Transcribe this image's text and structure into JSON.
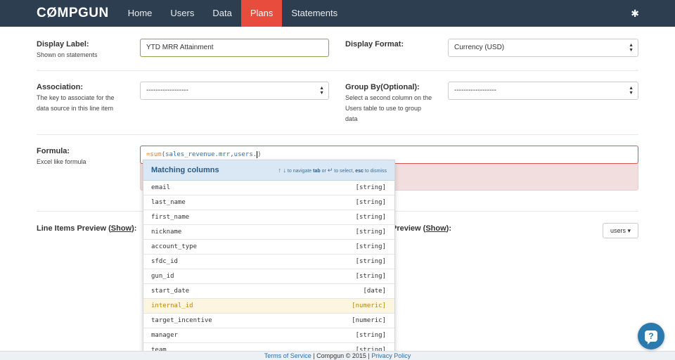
{
  "navbar": {
    "brand": "CØMPGUN",
    "items": [
      {
        "label": "Home"
      },
      {
        "label": "Users"
      },
      {
        "label": "Data"
      },
      {
        "label": "Plans",
        "active": true
      },
      {
        "label": "Statements"
      }
    ],
    "settings_icon": "gear-icon"
  },
  "form": {
    "display_label": {
      "label": "Display Label:",
      "help": "Shown on statements",
      "value": "YTD MRR Attainment"
    },
    "display_format": {
      "label": "Display Format:",
      "value": "Currency (USD)"
    },
    "association": {
      "label": "Association:",
      "help_line1": "The key to associate for the",
      "help_line2": "data source in this line item",
      "value": "------------------"
    },
    "group_by": {
      "label": "Group By(Optional):",
      "help_line1": "Select a second column on the",
      "help_line2": "Users table to use to group",
      "help_line3": "data",
      "value": "------------------"
    },
    "formula": {
      "label": "Formula:",
      "help": "Excel like formula",
      "eq": "=",
      "fn": "sum",
      "open": "(",
      "arg1": "sales_revenue.mrr",
      "comma": ",",
      "arg2": "users.",
      "close": ")"
    }
  },
  "preview": {
    "left_label": "Line Items Preview (",
    "left_link": "Show",
    "left_end": "):",
    "right_label": "Preview (",
    "right_link": "Show",
    "right_end": "):",
    "users_button": "users ▾"
  },
  "autocomplete": {
    "title": "Matching columns",
    "hint_arrows": "↑ ↓",
    "hint_navigate": "to navigate",
    "hint_tab": "tab",
    "hint_or": "or",
    "hint_enter": "↵",
    "hint_select": "to select,",
    "hint_esc": "esc",
    "hint_dismiss": "to dismiss",
    "items": [
      {
        "name": "email",
        "type": "[string]"
      },
      {
        "name": "last_name",
        "type": "[string]"
      },
      {
        "name": "first_name",
        "type": "[string]"
      },
      {
        "name": "nickname",
        "type": "[string]"
      },
      {
        "name": "account_type",
        "type": "[string]"
      },
      {
        "name": "sfdc_id",
        "type": "[string]"
      },
      {
        "name": "gun_id",
        "type": "[string]"
      },
      {
        "name": "start_date",
        "type": "[date]"
      },
      {
        "name": "internal_id",
        "type": "[numeric]",
        "highlighted": true
      },
      {
        "name": "target_incentive",
        "type": "[numeric]"
      },
      {
        "name": "manager",
        "type": "[string]"
      },
      {
        "name": "team",
        "type": "[string]"
      }
    ]
  },
  "footer": {
    "terms": "Terms of Service",
    "sep1": " | Compgun © 2015 | ",
    "privacy": "Privacy Policy"
  },
  "help_fab": {
    "label": "?"
  }
}
